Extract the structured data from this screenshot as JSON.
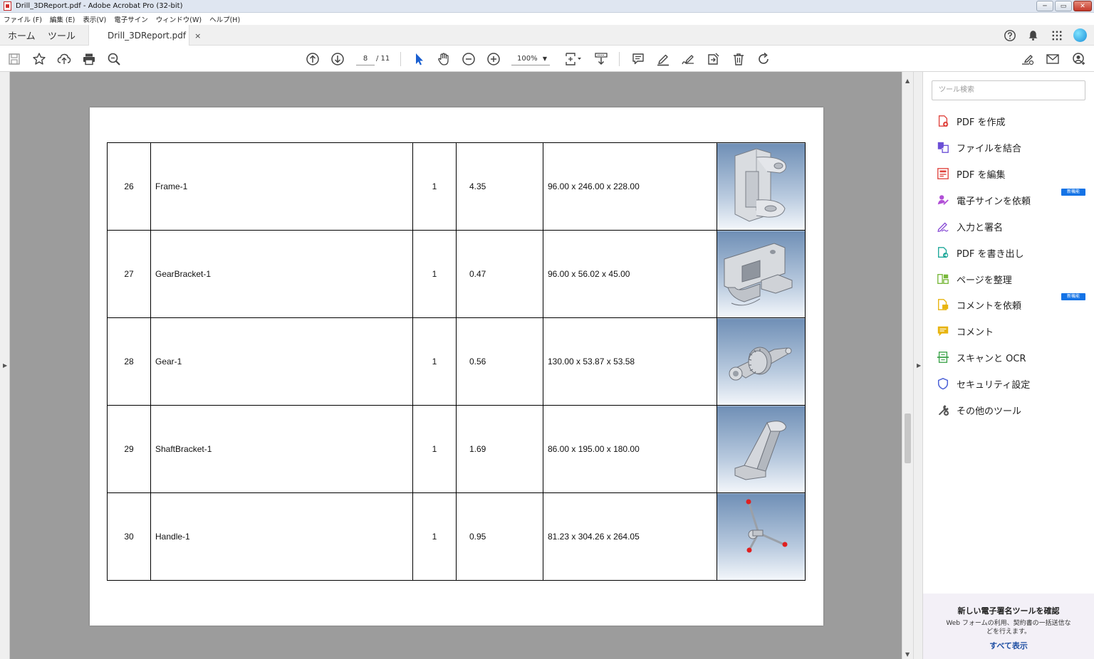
{
  "window": {
    "title": "Drill_3DReport.pdf - Adobe Acrobat Pro (32-bit)",
    "controls": {
      "minimize": "─",
      "maximize": "▭",
      "close": "✕"
    }
  },
  "menu": [
    "ファイル (F)",
    "編集 (E)",
    "表示(V)",
    "電子サイン",
    "ウィンドウ(W)",
    "ヘルプ(H)"
  ],
  "tabs": {
    "home": "ホーム",
    "tools": "ツール",
    "document": "Drill_3DReport.pdf",
    "close_symbol": "×"
  },
  "toolbar": {
    "current_page": "8",
    "total_pages": "/ 11",
    "zoom": "100%",
    "zoom_caret": "▼"
  },
  "scroll": {
    "up": "▲",
    "down": "▼",
    "left_panel_arrow": "▶",
    "right_panel_arrow": "▶"
  },
  "table": {
    "rows": [
      {
        "no": "26",
        "name": "Frame-1",
        "qty": "1",
        "mass": "4.35",
        "size": "96.00 x 246.00 x 228.00",
        "thumb": "frame-thumbnail"
      },
      {
        "no": "27",
        "name": "GearBracket-1",
        "qty": "1",
        "mass": "0.47",
        "size": "96.00 x 56.02 x 45.00",
        "thumb": "gear-bracket-thumbnail"
      },
      {
        "no": "28",
        "name": "Gear-1",
        "qty": "1",
        "mass": "0.56",
        "size": "130.00 x 53.87 x 53.58",
        "thumb": "gear-thumbnail"
      },
      {
        "no": "29",
        "name": "ShaftBracket-1",
        "qty": "1",
        "mass": "1.69",
        "size": "86.00 x 195.00 x 180.00",
        "thumb": "shaft-bracket-thumbnail"
      },
      {
        "no": "30",
        "name": "Handle-1",
        "qty": "1",
        "mass": "0.95",
        "size": "81.23 x 304.26 x 264.05",
        "thumb": "handle-thumbnail"
      }
    ]
  },
  "right_panel": {
    "search_placeholder": "ツール検索",
    "tools": [
      {
        "label": "PDF を作成",
        "icon": "create-pdf-icon",
        "color": "#e0443e"
      },
      {
        "label": "ファイルを結合",
        "icon": "combine-files-icon",
        "color": "#6b4fd6"
      },
      {
        "label": "PDF を編集",
        "icon": "edit-pdf-icon",
        "color": "#e0443e"
      },
      {
        "label": "電子サインを依頼",
        "icon": "request-esign-icon",
        "color": "#b14fd6",
        "badge": "新機能"
      },
      {
        "label": "入力と署名",
        "icon": "fill-sign-icon",
        "color": "#8a4fd6"
      },
      {
        "label": "PDF を書き出し",
        "icon": "export-pdf-icon",
        "color": "#1ea89a"
      },
      {
        "label": "ページを整理",
        "icon": "organize-pages-icon",
        "color": "#78b83a"
      },
      {
        "label": "コメントを依頼",
        "icon": "request-comments-icon",
        "color": "#e8b40e",
        "badge": "新機能"
      },
      {
        "label": "コメント",
        "icon": "comment-icon",
        "color": "#e8b40e"
      },
      {
        "label": "スキャンと OCR",
        "icon": "scan-ocr-icon",
        "color": "#3ba34a"
      },
      {
        "label": "セキュリティ設定",
        "icon": "security-icon",
        "color": "#4a5fd6"
      },
      {
        "label": "その他のツール",
        "icon": "more-tools-icon",
        "color": "#555555"
      }
    ],
    "promo": {
      "heading": "新しい電子署名ツールを確認",
      "body": "Web フォームの利用、契約書の一括送信などを行えます。",
      "link": "すべて表示"
    }
  }
}
